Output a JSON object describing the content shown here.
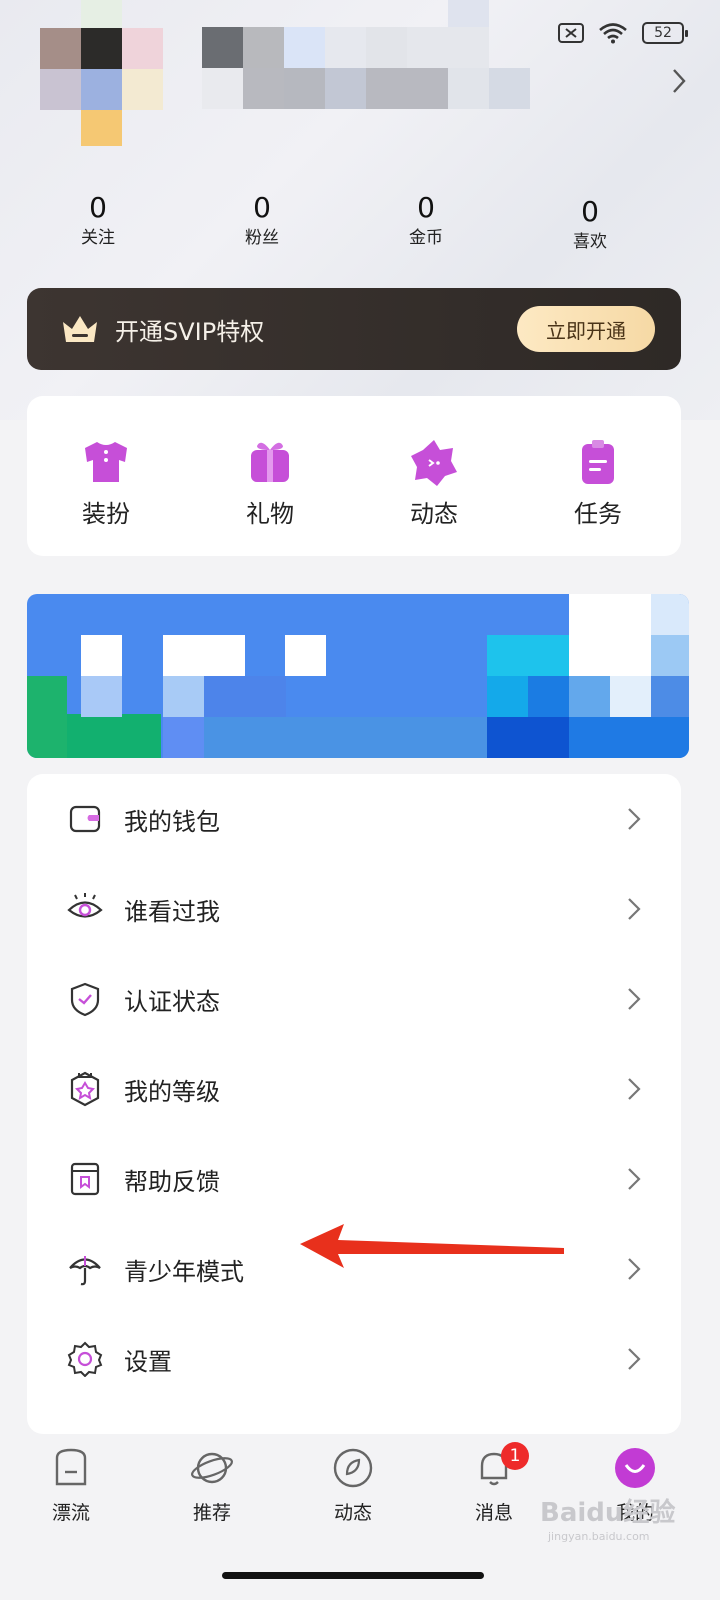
{
  "status_bar": {
    "battery": "52"
  },
  "stats": [
    {
      "value": "0",
      "label": "关注"
    },
    {
      "value": "0",
      "label": "粉丝"
    },
    {
      "value": "0",
      "label": "金币"
    },
    {
      "value": "0",
      "label": "喜欢"
    }
  ],
  "svip": {
    "text": "开通SVIP特权",
    "button": "立即开通"
  },
  "quick_actions": [
    {
      "label": "装扮",
      "icon": "shirt-icon"
    },
    {
      "label": "礼物",
      "icon": "gift-icon"
    },
    {
      "label": "动态",
      "icon": "star-bubble-icon"
    },
    {
      "label": "任务",
      "icon": "clipboard-icon"
    }
  ],
  "menu": [
    {
      "label": "我的钱包",
      "icon": "wallet-icon"
    },
    {
      "label": "谁看过我",
      "icon": "eye-icon"
    },
    {
      "label": "认证状态",
      "icon": "shield-check-icon"
    },
    {
      "label": "我的等级",
      "icon": "level-badge-icon"
    },
    {
      "label": "帮助反馈",
      "icon": "book-icon"
    },
    {
      "label": "青少年模式",
      "icon": "umbrella-icon"
    },
    {
      "label": "设置",
      "icon": "gear-icon"
    }
  ],
  "tabs": [
    {
      "label": "漂流",
      "icon": "drift-bottle-icon"
    },
    {
      "label": "推荐",
      "icon": "planet-icon"
    },
    {
      "label": "动态",
      "icon": "compass-leaf-icon"
    },
    {
      "label": "消息",
      "icon": "bell-icon",
      "badge": "1"
    },
    {
      "label": "我的",
      "icon": "smile-avatar-icon",
      "active": true
    }
  ],
  "watermark": {
    "text": "Baidu经验",
    "sub": "jingyan.baidu.com"
  },
  "colors": {
    "accent": "#c23bd4",
    "badge": "#ee2a2a",
    "svip_bg": "#3d3531",
    "svip_button": "#fbe3b6",
    "arrow": "#e8301c"
  }
}
